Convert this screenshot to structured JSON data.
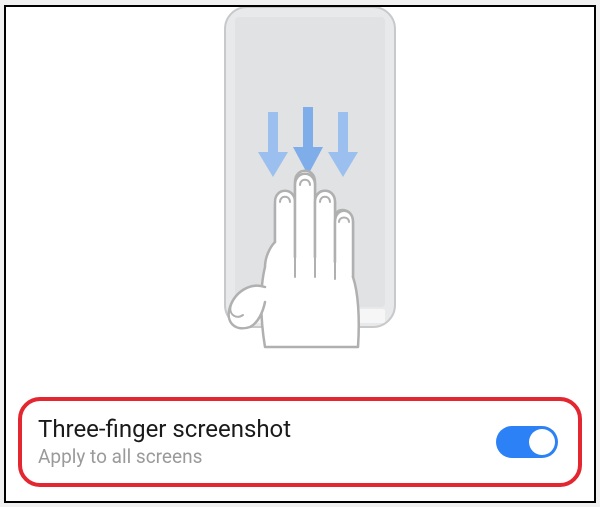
{
  "setting": {
    "title": "Three-finger screenshot",
    "subtitle": "Apply to all screens",
    "enabled": true
  },
  "colors": {
    "toggle_on": "#2b81f5",
    "highlight_border": "#e3262f",
    "subtitle_text": "#9a9a9a"
  }
}
